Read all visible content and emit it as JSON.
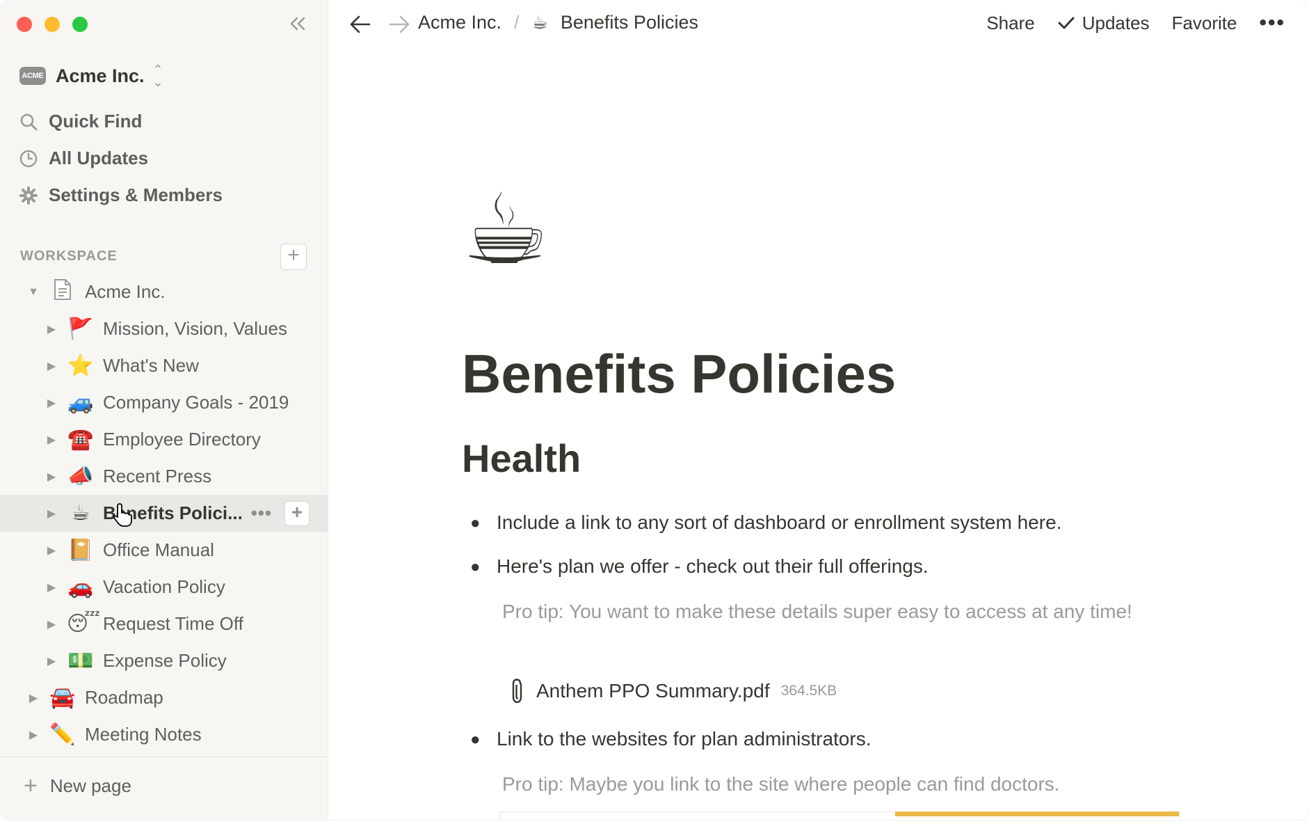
{
  "window": {
    "traffic_colors": {
      "close": "#ff5f57",
      "minimize": "#febc2e",
      "zoom": "#28c840"
    }
  },
  "sidebar": {
    "workspace_logo_text": "ACME",
    "workspace_name": "Acme Inc.",
    "nav": [
      {
        "label": "Quick Find",
        "icon": "search-icon"
      },
      {
        "label": "All Updates",
        "icon": "clock-icon"
      },
      {
        "label": "Settings & Members",
        "icon": "gear-icon"
      }
    ],
    "section_label": "WORKSPACE",
    "root": {
      "emoji": "📄",
      "label": "Acme Inc."
    },
    "pages": [
      {
        "emoji": "🚩",
        "label": "Mission, Vision, Values"
      },
      {
        "emoji": "⭐",
        "label": "What's New"
      },
      {
        "emoji": "🚙",
        "label": "Company Goals - 2019"
      },
      {
        "emoji": "☎️",
        "label": "Employee Directory"
      },
      {
        "emoji": "📣",
        "label": "Recent Press"
      },
      {
        "emoji": "☕",
        "label": "Benefits Polici...",
        "selected": true
      },
      {
        "emoji": "📔",
        "label": "Office Manual"
      },
      {
        "emoji": "🚗",
        "label": "Vacation Policy"
      },
      {
        "emoji": "😴",
        "label": "Request Time Off"
      },
      {
        "emoji": "💵",
        "label": "Expense Policy"
      }
    ],
    "top_pages": [
      {
        "emoji": "🚘",
        "label": "Roadmap"
      },
      {
        "emoji": "✏️",
        "label": "Meeting Notes"
      }
    ],
    "new_page_label": "New page"
  },
  "topbar": {
    "breadcrumb": [
      {
        "label": "Acme Inc."
      },
      {
        "emoji": "☕",
        "label": "Benefits Policies"
      }
    ],
    "separator": "/",
    "share": "Share",
    "updates": "Updates",
    "favorite": "Favorite",
    "more": "•••"
  },
  "page": {
    "icon": "☕",
    "title": "Benefits Policies",
    "heading": "Health",
    "bullets": [
      "Include a link to any sort of dashboard or enrollment system here.",
      "Here's plan we offer - check out their full offerings.",
      "Link to the websites for plan administrators."
    ],
    "tip1": "Pro tip: You want to make these details super easy to access at any time!",
    "file": {
      "name": "Anthem PPO Summary.pdf",
      "size": "364.5KB"
    },
    "tip2": "Pro tip: Maybe you link to the site where people can find doctors."
  }
}
